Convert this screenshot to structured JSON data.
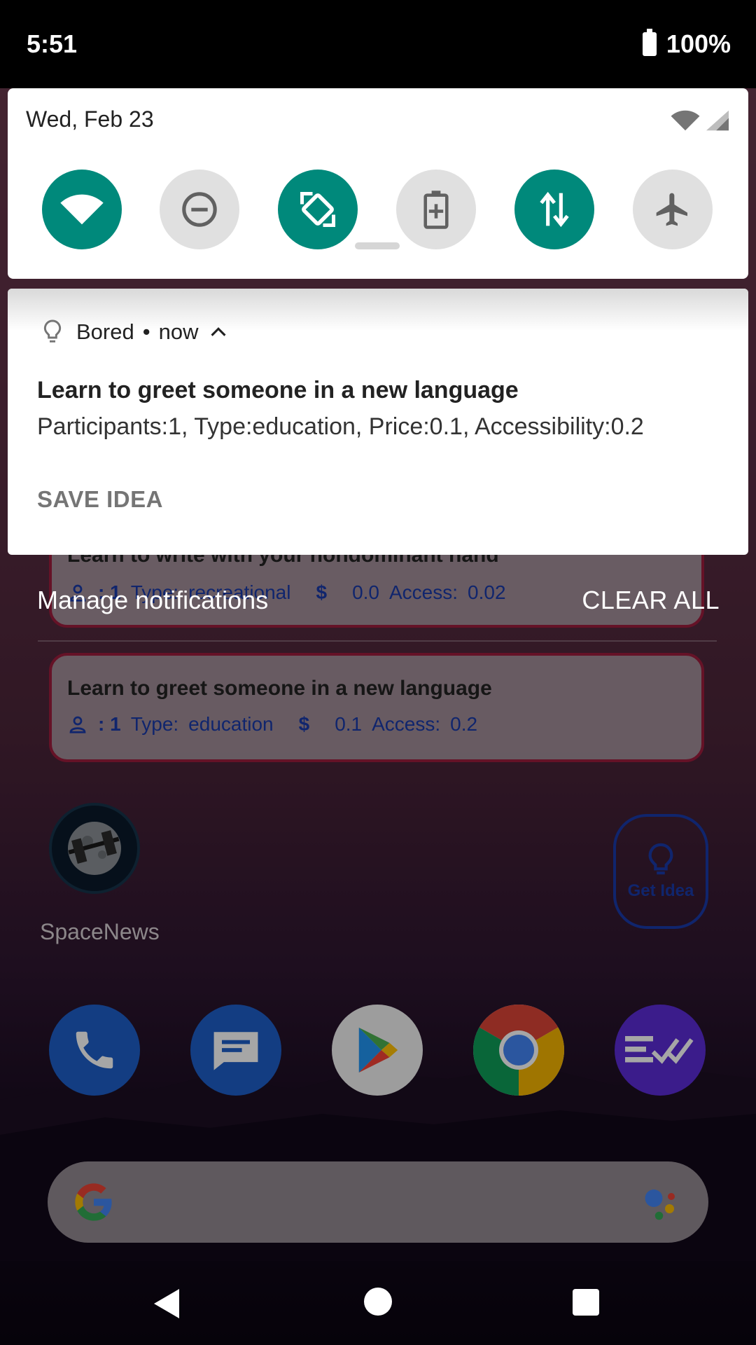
{
  "status_bar": {
    "time": "5:51",
    "battery": "100%"
  },
  "quick_settings": {
    "date": "Wed, Feb 23",
    "tiles": [
      {
        "name": "wifi",
        "state": "on"
      },
      {
        "name": "do-not-disturb",
        "state": "off"
      },
      {
        "name": "auto-rotate",
        "state": "on"
      },
      {
        "name": "battery-saver",
        "state": "off"
      },
      {
        "name": "mobile-data",
        "state": "on"
      },
      {
        "name": "airplane-mode",
        "state": "off"
      }
    ],
    "accent": "#00897b"
  },
  "notification": {
    "app_name": "Bored",
    "separator": "•",
    "time": "now",
    "title": "Learn to greet someone in a new language",
    "text": "Participants:1, Type:education, Price:0.1, Accessibility:0.2",
    "action": "SAVE IDEA"
  },
  "shade_footer": {
    "manage": "Manage notifications",
    "clear_all": "CLEAR ALL"
  },
  "widget_cards": [
    {
      "title": "Learn to write with your nondominant hand",
      "participants": ": 1",
      "type_label": "Type:",
      "type": "recreational",
      "currency": "$",
      "price": "0.0",
      "access_label": "Access:",
      "access": "0.02"
    },
    {
      "title": "Learn to greet someone in a new language",
      "participants": ": 1",
      "type_label": "Type:",
      "type": "education",
      "currency": "$",
      "price": "0.1",
      "access_label": "Access:",
      "access": "0.2"
    }
  ],
  "home": {
    "app_label": "SpaceNews",
    "widget_button": "Get Idea",
    "dock": [
      "phone",
      "messages",
      "play-store",
      "chrome",
      "tasks"
    ]
  }
}
